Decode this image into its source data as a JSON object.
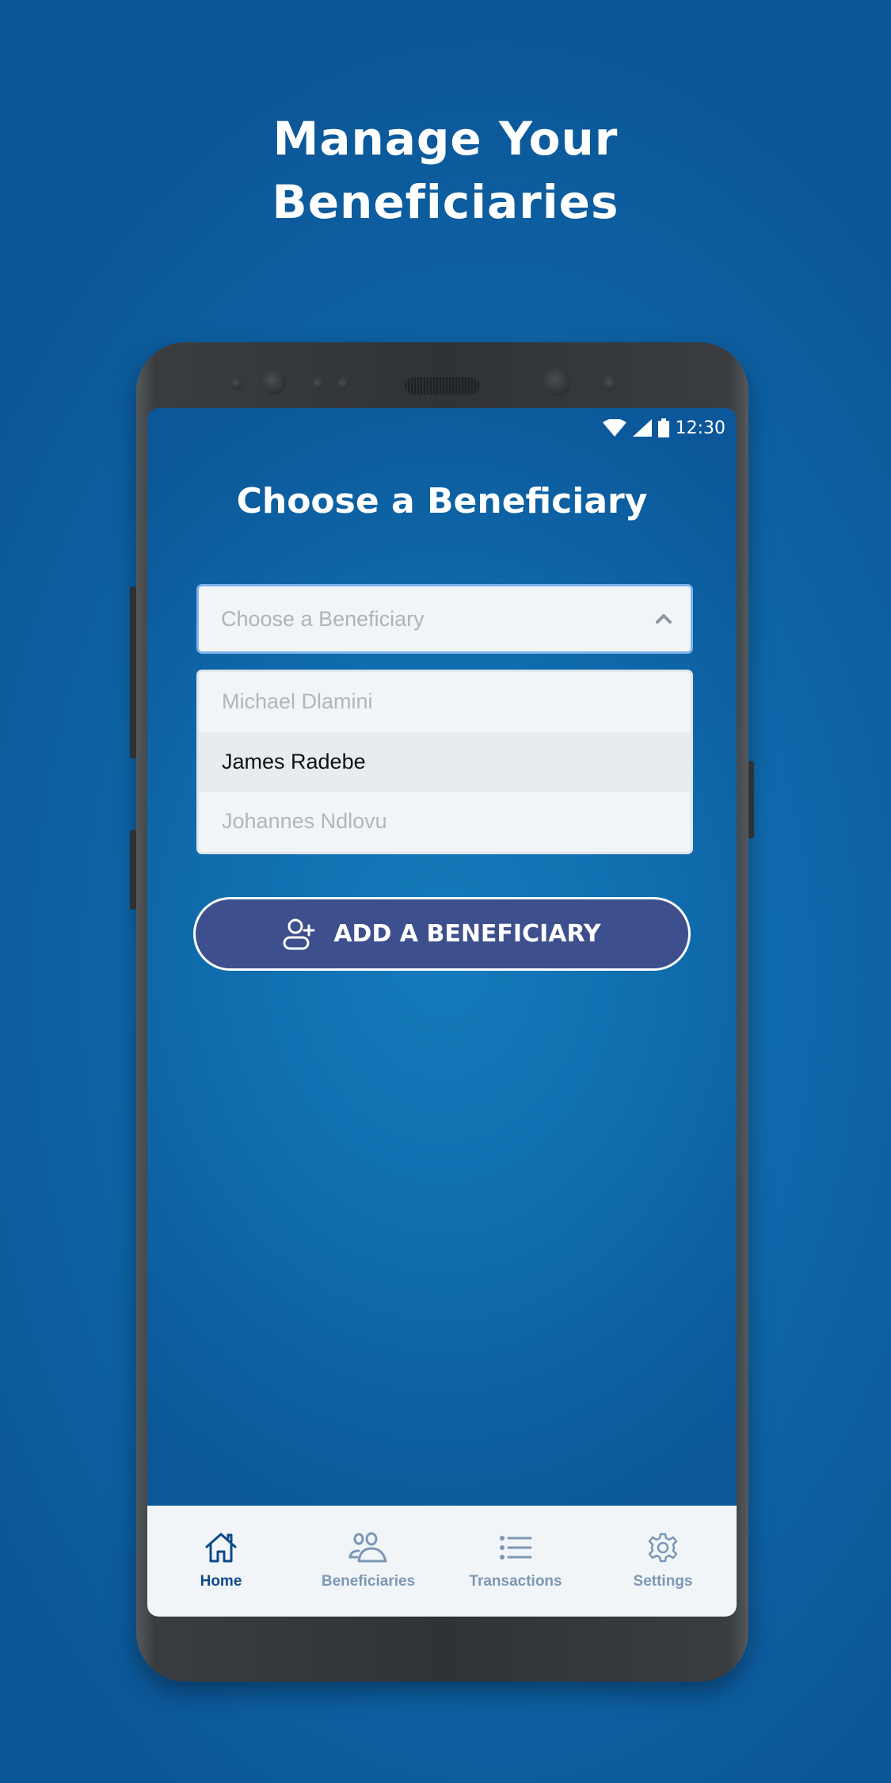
{
  "promo": {
    "title_line1": "Manage Your",
    "title_line2": "Beneficiaries"
  },
  "status_bar": {
    "icons": [
      "wifi-icon",
      "signal-icon",
      "battery-icon"
    ],
    "time": "12:30"
  },
  "screen": {
    "title": "Choose a Beneficiary",
    "select": {
      "placeholder": "Choose a Beneficiary",
      "state": "open",
      "icon": "chevron-up-icon"
    },
    "options": [
      {
        "label": "Michael Dlamini",
        "highlighted": false
      },
      {
        "label": "James Radebe",
        "highlighted": true
      },
      {
        "label": "Johannes Ndlovu",
        "highlighted": false
      }
    ],
    "add_button": {
      "label": "ADD A BENEFICIARY",
      "icon": "add-user-icon"
    }
  },
  "bottom_nav": {
    "items": [
      {
        "label": "Home",
        "icon": "home-icon",
        "active": true
      },
      {
        "label": "Beneficiaries",
        "icon": "users-icon",
        "active": false
      },
      {
        "label": "Transactions",
        "icon": "list-icon",
        "active": false
      },
      {
        "label": "Settings",
        "icon": "gear-icon",
        "active": false
      }
    ]
  },
  "colors": {
    "background": "#0f6aad",
    "button": "#3d4f8c",
    "select_border": "#7fb2ee",
    "nav_active": "#0e4a8a",
    "nav_inactive": "#7d97b5"
  }
}
